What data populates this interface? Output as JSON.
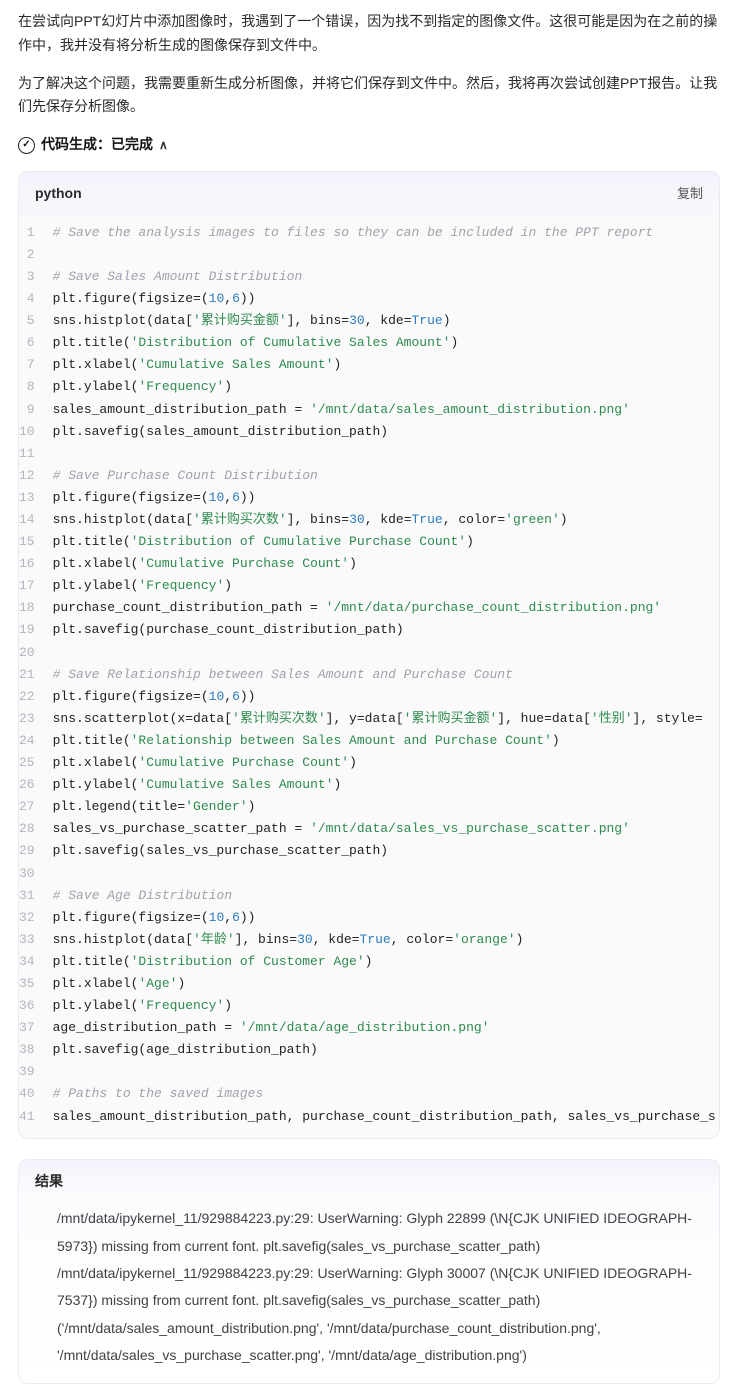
{
  "intro": {
    "p1": "在尝试向PPT幻灯片中添加图像时，我遇到了一个错误，因为找不到指定的图像文件。这很可能是因为在之前的操作中，我并没有将分析生成的图像保存到文件中。",
    "p2": "为了解决这个问题，我需要重新生成分析图像，并将它们保存到文件中。然后，我将再次尝试创建PPT报告。让我们先保存分析图像。"
  },
  "status": {
    "label": "代码生成：已完成",
    "check": "✓",
    "caret": "∧"
  },
  "codeHeader": {
    "lang": "python",
    "copy": "复制"
  },
  "code": [
    {
      "n": "1",
      "segs": [
        {
          "c": "tok-cm",
          "t": "# Save the analysis images to files so they can be included in the PPT report"
        }
      ]
    },
    {
      "n": "2",
      "segs": []
    },
    {
      "n": "3",
      "segs": [
        {
          "c": "tok-cm",
          "t": "# Save Sales Amount Distribution"
        }
      ]
    },
    {
      "n": "4",
      "segs": [
        {
          "t": "plt.figure(figsize=("
        },
        {
          "c": "tok-num",
          "t": "10"
        },
        {
          "t": ","
        },
        {
          "c": "tok-num",
          "t": "6"
        },
        {
          "t": "))"
        }
      ]
    },
    {
      "n": "5",
      "segs": [
        {
          "t": "sns.histplot(data["
        },
        {
          "c": "tok-str",
          "t": "'累计购买金额'"
        },
        {
          "t": "], bins="
        },
        {
          "c": "tok-num",
          "t": "30"
        },
        {
          "t": ", kde="
        },
        {
          "c": "tok-kw",
          "t": "True"
        },
        {
          "t": ")"
        }
      ]
    },
    {
      "n": "6",
      "segs": [
        {
          "t": "plt.title("
        },
        {
          "c": "tok-str",
          "t": "'Distribution of Cumulative Sales Amount'"
        },
        {
          "t": ")"
        }
      ]
    },
    {
      "n": "7",
      "segs": [
        {
          "t": "plt.xlabel("
        },
        {
          "c": "tok-str",
          "t": "'Cumulative Sales Amount'"
        },
        {
          "t": ")"
        }
      ]
    },
    {
      "n": "8",
      "segs": [
        {
          "t": "plt.ylabel("
        },
        {
          "c": "tok-str",
          "t": "'Frequency'"
        },
        {
          "t": ")"
        }
      ]
    },
    {
      "n": "9",
      "segs": [
        {
          "t": "sales_amount_distribution_path = "
        },
        {
          "c": "tok-str",
          "t": "'/mnt/data/sales_amount_distribution.png'"
        }
      ]
    },
    {
      "n": "10",
      "segs": [
        {
          "t": "plt.savefig(sales_amount_distribution_path)"
        }
      ]
    },
    {
      "n": "11",
      "segs": []
    },
    {
      "n": "12",
      "segs": [
        {
          "c": "tok-cm",
          "t": "# Save Purchase Count Distribution"
        }
      ]
    },
    {
      "n": "13",
      "segs": [
        {
          "t": "plt.figure(figsize=("
        },
        {
          "c": "tok-num",
          "t": "10"
        },
        {
          "t": ","
        },
        {
          "c": "tok-num",
          "t": "6"
        },
        {
          "t": "))"
        }
      ]
    },
    {
      "n": "14",
      "segs": [
        {
          "t": "sns.histplot(data["
        },
        {
          "c": "tok-str",
          "t": "'累计购买次数'"
        },
        {
          "t": "], bins="
        },
        {
          "c": "tok-num",
          "t": "30"
        },
        {
          "t": ", kde="
        },
        {
          "c": "tok-kw",
          "t": "True"
        },
        {
          "t": ", color="
        },
        {
          "c": "tok-str",
          "t": "'green'"
        },
        {
          "t": ")"
        }
      ]
    },
    {
      "n": "15",
      "segs": [
        {
          "t": "plt.title("
        },
        {
          "c": "tok-str",
          "t": "'Distribution of Cumulative Purchase Count'"
        },
        {
          "t": ")"
        }
      ]
    },
    {
      "n": "16",
      "segs": [
        {
          "t": "plt.xlabel("
        },
        {
          "c": "tok-str",
          "t": "'Cumulative Purchase Count'"
        },
        {
          "t": ")"
        }
      ]
    },
    {
      "n": "17",
      "segs": [
        {
          "t": "plt.ylabel("
        },
        {
          "c": "tok-str",
          "t": "'Frequency'"
        },
        {
          "t": ")"
        }
      ]
    },
    {
      "n": "18",
      "segs": [
        {
          "t": "purchase_count_distribution_path = "
        },
        {
          "c": "tok-str",
          "t": "'/mnt/data/purchase_count_distribution.png'"
        }
      ]
    },
    {
      "n": "19",
      "segs": [
        {
          "t": "plt.savefig(purchase_count_distribution_path)"
        }
      ]
    },
    {
      "n": "20",
      "segs": []
    },
    {
      "n": "21",
      "segs": [
        {
          "c": "tok-cm",
          "t": "# Save Relationship between Sales Amount and Purchase Count"
        }
      ]
    },
    {
      "n": "22",
      "segs": [
        {
          "t": "plt.figure(figsize=("
        },
        {
          "c": "tok-num",
          "t": "10"
        },
        {
          "t": ","
        },
        {
          "c": "tok-num",
          "t": "6"
        },
        {
          "t": "))"
        }
      ]
    },
    {
      "n": "23",
      "segs": [
        {
          "t": "sns.scatterplot(x=data["
        },
        {
          "c": "tok-str",
          "t": "'累计购买次数'"
        },
        {
          "t": "], y=data["
        },
        {
          "c": "tok-str",
          "t": "'累计购买金额'"
        },
        {
          "t": "], hue=data["
        },
        {
          "c": "tok-str",
          "t": "'性别'"
        },
        {
          "t": "], style="
        }
      ]
    },
    {
      "n": "24",
      "segs": [
        {
          "t": "plt.title("
        },
        {
          "c": "tok-str",
          "t": "'Relationship between Sales Amount and Purchase Count'"
        },
        {
          "t": ")"
        }
      ]
    },
    {
      "n": "25",
      "segs": [
        {
          "t": "plt.xlabel("
        },
        {
          "c": "tok-str",
          "t": "'Cumulative Purchase Count'"
        },
        {
          "t": ")"
        }
      ]
    },
    {
      "n": "26",
      "segs": [
        {
          "t": "plt.ylabel("
        },
        {
          "c": "tok-str",
          "t": "'Cumulative Sales Amount'"
        },
        {
          "t": ")"
        }
      ]
    },
    {
      "n": "27",
      "segs": [
        {
          "t": "plt.legend(title="
        },
        {
          "c": "tok-str",
          "t": "'Gender'"
        },
        {
          "t": ")"
        }
      ]
    },
    {
      "n": "28",
      "segs": [
        {
          "t": "sales_vs_purchase_scatter_path = "
        },
        {
          "c": "tok-str",
          "t": "'/mnt/data/sales_vs_purchase_scatter.png'"
        }
      ]
    },
    {
      "n": "29",
      "segs": [
        {
          "t": "plt.savefig(sales_vs_purchase_scatter_path)"
        }
      ]
    },
    {
      "n": "30",
      "segs": []
    },
    {
      "n": "31",
      "segs": [
        {
          "c": "tok-cm",
          "t": "# Save Age Distribution"
        }
      ]
    },
    {
      "n": "32",
      "segs": [
        {
          "t": "plt.figure(figsize=("
        },
        {
          "c": "tok-num",
          "t": "10"
        },
        {
          "t": ","
        },
        {
          "c": "tok-num",
          "t": "6"
        },
        {
          "t": "))"
        }
      ]
    },
    {
      "n": "33",
      "segs": [
        {
          "t": "sns.histplot(data["
        },
        {
          "c": "tok-str",
          "t": "'年龄'"
        },
        {
          "t": "], bins="
        },
        {
          "c": "tok-num",
          "t": "30"
        },
        {
          "t": ", kde="
        },
        {
          "c": "tok-kw",
          "t": "True"
        },
        {
          "t": ", color="
        },
        {
          "c": "tok-str",
          "t": "'orange'"
        },
        {
          "t": ")"
        }
      ]
    },
    {
      "n": "34",
      "segs": [
        {
          "t": "plt.title("
        },
        {
          "c": "tok-str",
          "t": "'Distribution of Customer Age'"
        },
        {
          "t": ")"
        }
      ]
    },
    {
      "n": "35",
      "segs": [
        {
          "t": "plt.xlabel("
        },
        {
          "c": "tok-str",
          "t": "'Age'"
        },
        {
          "t": ")"
        }
      ]
    },
    {
      "n": "36",
      "segs": [
        {
          "t": "plt.ylabel("
        },
        {
          "c": "tok-str",
          "t": "'Frequency'"
        },
        {
          "t": ")"
        }
      ]
    },
    {
      "n": "37",
      "segs": [
        {
          "t": "age_distribution_path = "
        },
        {
          "c": "tok-str",
          "t": "'/mnt/data/age_distribution.png'"
        }
      ]
    },
    {
      "n": "38",
      "segs": [
        {
          "t": "plt.savefig(age_distribution_path)"
        }
      ]
    },
    {
      "n": "39",
      "segs": []
    },
    {
      "n": "40",
      "segs": [
        {
          "c": "tok-cm",
          "t": "# Paths to the saved images"
        }
      ]
    },
    {
      "n": "41",
      "segs": [
        {
          "t": "sales_amount_distribution_path, purchase_count_distribution_path, sales_vs_purchase_s"
        }
      ]
    }
  ],
  "result": {
    "title": "结果",
    "lines": [
      "/mnt/data/ipykernel_11/929884223.py:29: UserWarning: Glyph 22899 (\\N{CJK UNIFIED IDEOGRAPH-5973}) missing from current font. plt.savefig(sales_vs_purchase_scatter_path)",
      "/mnt/data/ipykernel_11/929884223.py:29: UserWarning: Glyph 30007 (\\N{CJK UNIFIED IDEOGRAPH-7537}) missing from current font. plt.savefig(sales_vs_purchase_scatter_path)",
      "('/mnt/data/sales_amount_distribution.png', '/mnt/data/purchase_count_distribution.png', '/mnt/data/sales_vs_purchase_scatter.png', '/mnt/data/age_distribution.png')"
    ]
  }
}
